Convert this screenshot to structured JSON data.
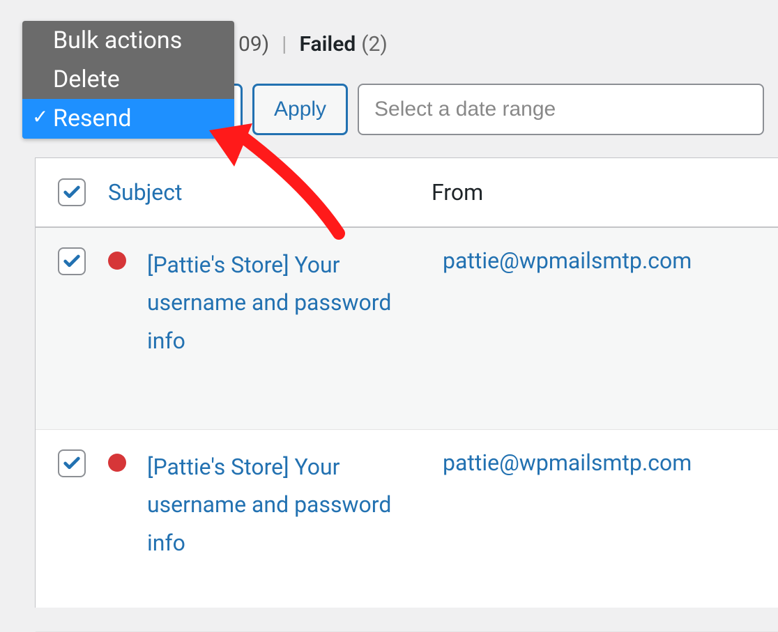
{
  "filters": {
    "count_partial": "09)",
    "divider": "|",
    "failed_label": "Failed",
    "failed_count": "(2)"
  },
  "bulk_dropdown": {
    "items": [
      {
        "label": "Bulk actions",
        "selected": false
      },
      {
        "label": "Delete",
        "selected": false
      },
      {
        "label": "Resend",
        "selected": true
      }
    ]
  },
  "apply_button": "Apply",
  "date_input": {
    "placeholder": "Select a date range",
    "value": ""
  },
  "columns": {
    "subject": "Subject",
    "from": "From"
  },
  "rows": [
    {
      "checked": true,
      "status": "failed",
      "subject": "[Pattie's Store] Your username and password info",
      "from": "pattie@wpmailsmtp.com"
    },
    {
      "checked": true,
      "status": "failed",
      "subject": "[Pattie's Store] Your username and password info",
      "from": "pattie@wpmailsmtp.com"
    }
  ],
  "colors": {
    "link": "#2271b1",
    "danger": "#d63638",
    "dropdown_bg": "#6b6b6b",
    "dropdown_selected": "#1e90ff"
  }
}
